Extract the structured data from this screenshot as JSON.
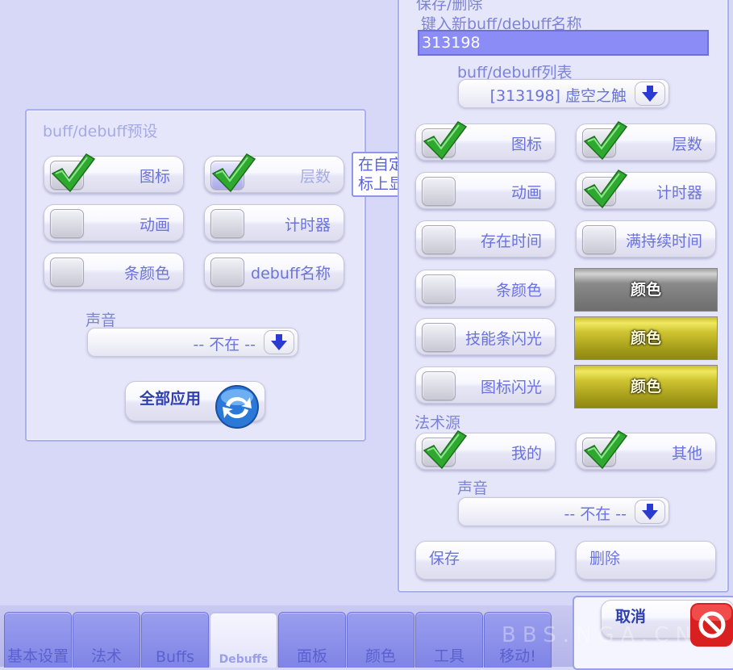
{
  "left_panel": {
    "title": "buff/debuff预设",
    "icon_label": "图标",
    "stacks_label": "层数",
    "animation_label": "动画",
    "timer_label": "计时器",
    "barcolor_label": "条颜色",
    "debuffname_label": "debuff名称",
    "sound_label": "声音",
    "sound_value": "-- 不在 --",
    "apply_all_label": "全部应用"
  },
  "tooltip": {
    "line1": "在自定义debuff图",
    "line2": "标上显示堆叠层数."
  },
  "right_panel": {
    "section_title": "保存/删除",
    "new_name_label": "键入新buff/debuff名称",
    "new_name_value": "313198",
    "list_label": "buff/debuff列表",
    "list_value": "[313198] 虚空之触",
    "icon_label": "图标",
    "stacks_label": "层数",
    "animation_label": "动画",
    "timer_label": "计时器",
    "exist_time_label": "存在时间",
    "full_duration_label": "满持续时间",
    "barcolor_label": "条颜色",
    "skillbar_flash_label": "技能条闪光",
    "icon_flash_label": "图标闪光",
    "color_button": "颜色",
    "spell_source_label": "法术源",
    "mine_label": "我的",
    "other_label": "其他",
    "sound_label": "声音",
    "sound_value": "-- 不在 --",
    "save_label": "保存",
    "delete_label": "删除"
  },
  "cancel_label": "取消",
  "tabs": [
    "基本设置",
    "法术",
    "Buffs",
    "Debuffs",
    "面板",
    "颜色",
    "工具",
    "移动!"
  ],
  "active_tab": "Debuffs",
  "watermark": "BBS.NGA.CN",
  "colors": {
    "background": "#d7d7f7",
    "accent": "#7f84e6",
    "text": "#6a72de",
    "input_fill": "#8c8cf6",
    "swatch_gray": "#8a8a8a",
    "swatch_yellow": "#cfc532",
    "cancel_red": "#d92020"
  }
}
